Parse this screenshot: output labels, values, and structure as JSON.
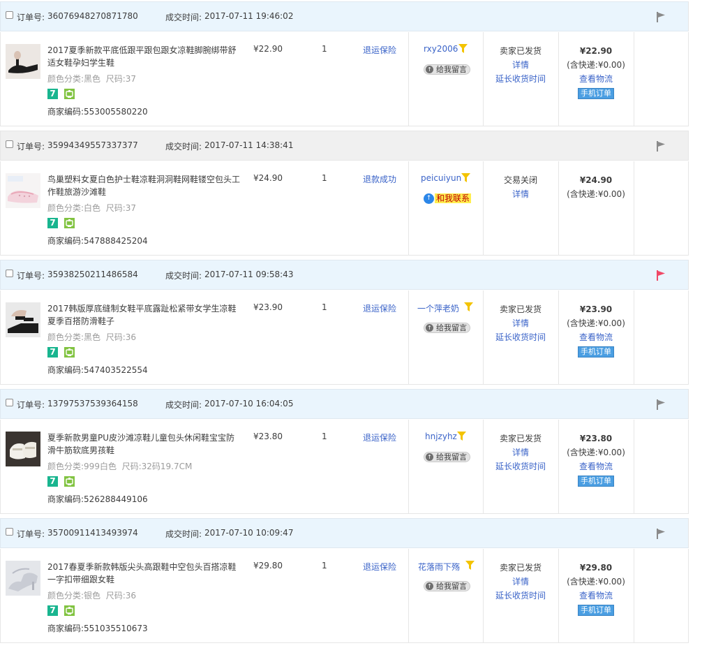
{
  "labels": {
    "order_no": "订单号:",
    "deal_time": "成交时间:",
    "sku_color": "颜色分类:",
    "sku_size": "尺码:",
    "merchant_code": "商家编码:",
    "give_message": "给我留言",
    "contact_me": "和我联系",
    "details": "详情",
    "view_logistics": "查看物流",
    "extend_receipt": "延长收货时间",
    "mobile_order": "手机订单",
    "badge_7": "7"
  },
  "colors": {
    "link": "#3a63c8",
    "header_bg": "#eaf5fd",
    "closed_header_bg": "#f0f0f0",
    "flag_red": "#f04866",
    "flag_gray": "#8a8a8a"
  },
  "orders": [
    {
      "order_no": "36076948270871780",
      "deal_time": "2017-07-11 19:46:02",
      "title": "2017夏季新款平底低跟平跟包跟女凉鞋脚腕绑带舒适女鞋孕妇学生鞋",
      "color": "黑色",
      "size": "37",
      "code": "553005580220",
      "price": "¥22.90",
      "qty": "1",
      "service": "退运保险",
      "buyer": "rxy2006",
      "status": "卖家已发货",
      "total": "¥22.90",
      "shipping": "(含快递:¥0.00)",
      "flag": "flag-gray-icon",
      "state": "shipped"
    },
    {
      "order_no": "35994349557337377",
      "deal_time": "2017-07-11 14:38:41",
      "title": "鸟巢塑料女夏白色护士鞋凉鞋洞洞鞋网鞋镂空包头工作鞋旅游沙滩鞋",
      "color": "白色",
      "size": "37",
      "code": "547888425204",
      "price": "¥24.90",
      "qty": "1",
      "service": "退款成功",
      "buyer": "peicuiyun",
      "status": "交易关闭",
      "total": "¥24.90",
      "shipping": "(含快递:¥0.00)",
      "flag": "flag-gray-icon",
      "state": "closed"
    },
    {
      "order_no": "35938250211486584",
      "deal_time": "2017-07-11 09:58:43",
      "title": "2017韩版厚底缝制女鞋平底露趾松紧带女学生凉鞋夏季百搭防滑鞋子",
      "color": "黑色",
      "size": "36",
      "code": "547403522554",
      "price": "¥23.90",
      "qty": "1",
      "service": "退运保险",
      "buyer": "一个萍老奶",
      "status": "卖家已发货",
      "total": "¥23.90",
      "shipping": "(含快递:¥0.00)",
      "flag": "flag-red-icon",
      "state": "shipped"
    },
    {
      "order_no": "13797537539364158",
      "deal_time": "2017-07-10 16:04:05",
      "title": "夏季新款男童PU皮沙滩凉鞋儿童包头休闲鞋宝宝防滑牛筋软底男孩鞋",
      "color": "999白色",
      "size": "32码19.7CM",
      "code": "526288449106",
      "price": "¥23.80",
      "qty": "1",
      "service": "退运保险",
      "buyer": "hnjzyhz",
      "status": "卖家已发货",
      "total": "¥23.80",
      "shipping": "(含快递:¥0.00)",
      "flag": "flag-gray-icon",
      "state": "shipped"
    },
    {
      "order_no": "35700911413493974",
      "deal_time": "2017-07-10 10:09:47",
      "title": "2017春夏季新款韩版尖头高跟鞋中空包头百搭凉鞋一字扣带细跟女鞋",
      "color": "银色",
      "size": "36",
      "code": "551035510673",
      "price": "¥29.80",
      "qty": "1",
      "service": "退运保险",
      "buyer": "花落雨下殇",
      "status": "卖家已发货",
      "total": "¥29.80",
      "shipping": "(含快递:¥0.00)",
      "flag": "flag-gray-icon",
      "state": "shipped"
    }
  ]
}
